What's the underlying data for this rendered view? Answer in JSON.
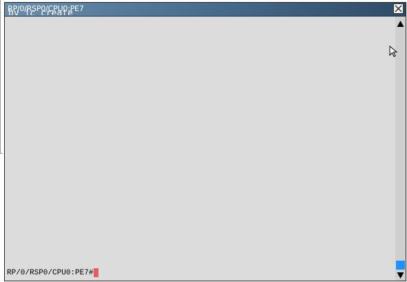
{
  "window": {
    "title": "RP/0/RSP0/CPU0:PE7",
    "ghost_text": "by ic create"
  },
  "terminal": {
    "prompt": "RP/0/RSP0/CPU0:PE7#"
  },
  "colors": {
    "titlebar_start": "#6a8eaa",
    "titlebar_end": "#2d4b66",
    "terminal_bg": "#dcdcdc",
    "cursor": "#e06060",
    "scroll_thumb": "#1e90ff"
  },
  "icons": {
    "close": "close-icon",
    "scroll_up": "arrow-up-icon",
    "scroll_down": "arrow-down-icon",
    "pointer": "mouse-pointer-icon"
  }
}
